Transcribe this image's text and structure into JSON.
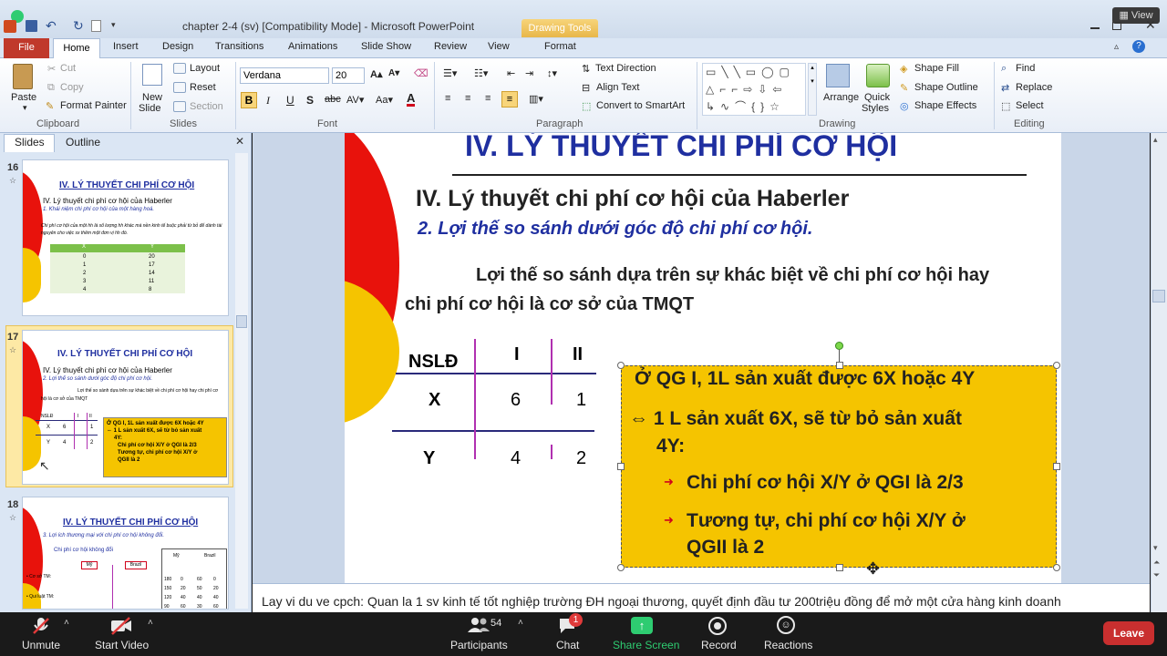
{
  "window": {
    "title": "chapter 2-4 (sv) [Compatibility Mode]  -  Microsoft PowerPoint",
    "contextual_tab_group": "Drawing Tools",
    "view_label": "View"
  },
  "tabs": [
    "File",
    "Home",
    "Insert",
    "Design",
    "Transitions",
    "Animations",
    "Slide Show",
    "Review",
    "View",
    "Format"
  ],
  "ribbon": {
    "clipboard": {
      "paste": "Paste",
      "cut": "Cut",
      "copy": "Copy",
      "format_painter": "Format Painter",
      "label": "Clipboard"
    },
    "slides": {
      "new_slide": "New",
      "new_slide2": "Slide",
      "layout": "Layout",
      "reset": "Reset",
      "section": "Section",
      "label": "Slides"
    },
    "font": {
      "font_name": "Verdana",
      "font_size": "20",
      "label": "Font"
    },
    "paragraph": {
      "text_direction": "Text Direction",
      "align_text": "Align Text",
      "convert_smartart": "Convert to SmartArt",
      "label": "Paragraph"
    },
    "drawing": {
      "arrange": "Arrange",
      "quick_styles": "Quick",
      "quick_styles2": "Styles",
      "shape_fill": "Shape Fill",
      "shape_outline": "Shape Outline",
      "shape_effects": "Shape Effects",
      "label": "Drawing"
    },
    "editing": {
      "find": "Find",
      "replace": "Replace",
      "select": "Select",
      "label": "Editing"
    }
  },
  "left_pane": {
    "tab_slides": "Slides",
    "tab_outline": "Outline",
    "thumbnails": [
      {
        "number": "16",
        "title": "IV. LÝ THUYẾT CHI PHÍ CƠ HỘI",
        "line1": "IV. Lý thuyết chi phí cơ hội của Haberler",
        "line2": "1. Khái niệm chi phí cơ hội của một hàng hoá.",
        "body": "Chi phí cơ hội của một hh là số lượng hh khác mà nền kinh tế buộc phải từ bỏ để dành tài nguyên cho việc sx thêm một đơn vị hh đó.",
        "table_head": [
          "X",
          "Y"
        ],
        "table_rows": [
          [
            "0",
            "20"
          ],
          [
            "1",
            "17"
          ],
          [
            "2",
            "14"
          ],
          [
            "3",
            "11"
          ],
          [
            "4",
            "8"
          ]
        ]
      },
      {
        "number": "17",
        "title": "IV. LÝ THUYẾT CHI PHÍ CƠ HỘI",
        "line1": "IV. Lý thuyết chi phí cơ hội của Haberler",
        "line2": "2. Lợi thế so sánh dưới góc độ chi phí cơ hội.",
        "body": "Lợi thế so sánh dựa trên sự khác biệt về chi phí cơ hội hay chi phí cơ hội là cơ sở của TMQT"
      },
      {
        "number": "18",
        "title": "IV. LÝ THUYẾT CHI PHÍ CƠ HỘI",
        "line1": "3. Lợi ích thương mại với chi phí cơ hội không đổi.",
        "line2": "Chi phí cơ hội không đổi",
        "label_my": "Mỹ",
        "label_brazil": "Brazil",
        "label_coso": "• Cơ sở TM:",
        "label_quiluat": "• Qui luật TM:",
        "table_rows": [
          [
            "180",
            "0",
            "60",
            "0"
          ],
          [
            "150",
            "20",
            "50",
            "20"
          ],
          [
            "120",
            "40",
            "40",
            "40"
          ],
          [
            "90",
            "60",
            "30",
            "60"
          ]
        ]
      }
    ]
  },
  "slide": {
    "heading": "IV. LÝ THUYẾT CHI PHÍ CƠ HỘI",
    "subheading": "IV. Lý thuyết chi phí cơ hội của Haberler",
    "point": "2. Lợi thế so sánh dưới góc độ chi phí cơ hội.",
    "body_line1": "Lợi thế so sánh dựa trên sự khác biệt về chi phí cơ hội hay",
    "body_line2": "chi phí cơ hội là cơ sở của TMQT",
    "table": {
      "head": [
        "NSLĐ",
        "I",
        "II"
      ],
      "rows": [
        [
          "X",
          "6",
          "1"
        ],
        [
          "Y",
          "4",
          "2"
        ]
      ]
    },
    "callout": {
      "line1": "Ở QG I, 1L sản xuất được 6X hoặc 4Y",
      "line2a": "⇔ 1 L sản xuất 6X, sẽ từ bỏ sản xuất",
      "line2b": "4Y:",
      "bullet1": "Chi phí cơ hội  X/Y ở QGI là 2/3",
      "bullet2a": "Tương tự, chi phí cơ hội X/Y ở",
      "bullet2b": "QGII là 2"
    }
  },
  "notes": "Lay vi du ve cpch: Quan la 1 sv kinh tế tốt nghiệp trường ĐH ngoại thương, quyết định đầu tư 200triệu đồng để mở một cửa hàng kinh doanh",
  "zoom": {
    "unmute": "Unmute",
    "start_video": "Start Video",
    "participants": "Participants",
    "participants_count": "54",
    "chat": "Chat",
    "chat_badge": "1",
    "share_screen": "Share Screen",
    "record": "Record",
    "reactions": "Reactions",
    "leave": "Leave"
  },
  "colors": {
    "slide_title": "#1f2fa0",
    "callout_bg": "#f5c400",
    "table_purple": "#b02fb0",
    "table_navy": "#2a2a7a",
    "bullet_red": "#d0021b",
    "share_green": "#2ecc71",
    "leave_red": "#c92f2f"
  }
}
